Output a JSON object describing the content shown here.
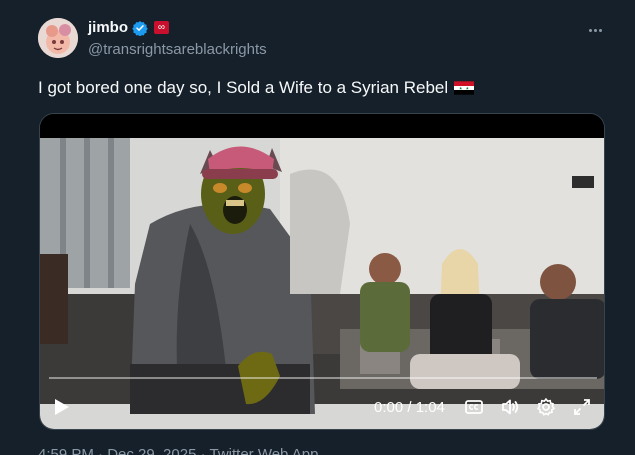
{
  "author": {
    "display_name": "jimbo",
    "handle": "@transrightsareblackrights",
    "verified_icon": "verified-badge-icon",
    "affiliation_icon": "affiliate-badge-icon",
    "badge_color": "#1d9bf0"
  },
  "tweet": {
    "text": "I got bored one day so, I Sold a Wife to a Syrian Rebel",
    "flag_icon": "syria-flag-icon"
  },
  "video": {
    "current_time": "0:00",
    "separator": " / ",
    "duration": "1:04",
    "time_display": "0:00 / 1:04",
    "progress": 0,
    "captions_icon": "closed-captions-icon",
    "volume_icon": "volume-icon",
    "settings_icon": "settings-icon",
    "fullscreen_icon": "fullscreen-icon",
    "play_icon": "play-icon"
  },
  "footer": {
    "meta": "4:59 PM · Dec 29, 2025 · Twitter Web App"
  },
  "colors": {
    "background": "#15202b",
    "text": "#f7f9f9",
    "muted": "#8b98a5",
    "border": "#38444d"
  }
}
